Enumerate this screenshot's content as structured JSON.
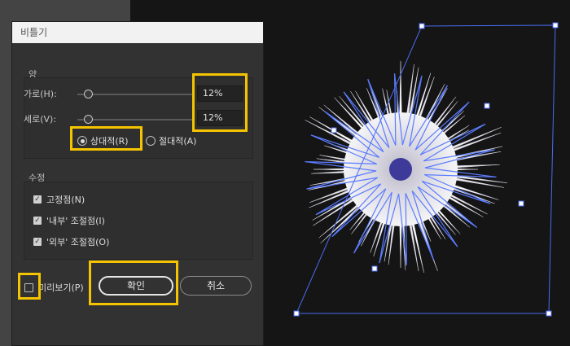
{
  "dialog": {
    "title": "비틀기",
    "amount_group_label": "양",
    "horizontal_label": "가로(H):",
    "horizontal_value": "12%",
    "horizontal_slider_level": 0.1,
    "vertical_label": "세로(V):",
    "vertical_value": "12%",
    "vertical_slider_level": 0.1,
    "relative_label": "상대적(R)",
    "absolute_label": "절대적(A)",
    "selected_mode": "relative",
    "modify_group_label": "수정",
    "anchor_points_label": "고정점(N)",
    "in_control_label": "'내부' 조절점(I)",
    "out_control_label": "'외부' 조절점(O)",
    "preview_label": "미리보기(P)",
    "ok_label": "확인",
    "cancel_label": "취소"
  },
  "colors": {
    "highlight": "#f5c400",
    "selection_path": "#5b7cff",
    "canvas": "#151515"
  },
  "icons": [
    "check-icon",
    "radio-icon"
  ]
}
